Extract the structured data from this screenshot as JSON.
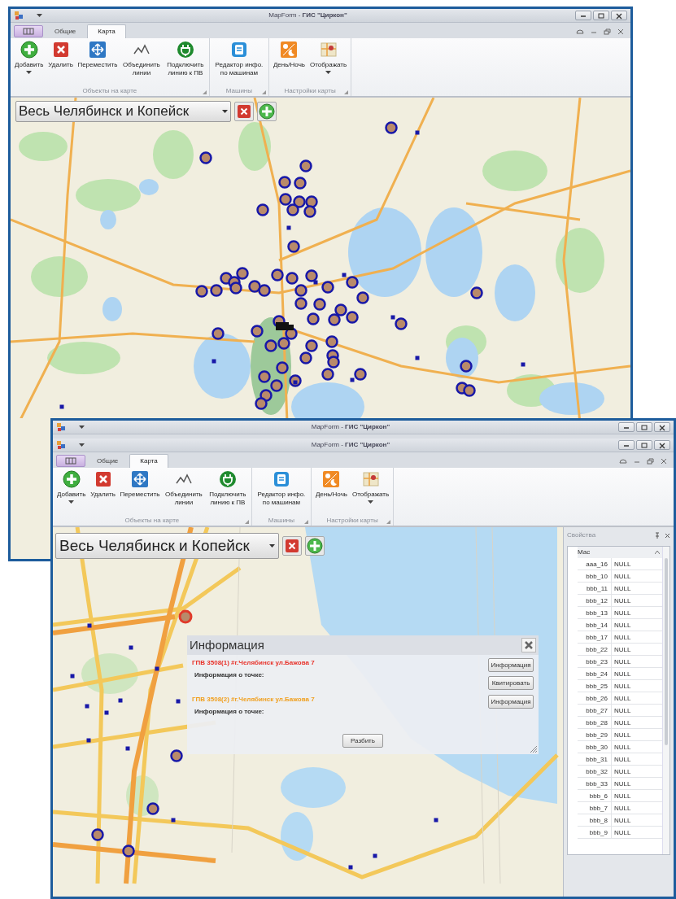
{
  "windows": [
    {
      "title_bars": [
        "MapForm - **ГИС \"Циркон\"**"
      ],
      "tabs": [
        {
          "kind": "app"
        },
        {
          "label": "Общие",
          "kind": "tab",
          "selected": false
        },
        {
          "label": "Карта",
          "kind": "tab",
          "selected": true
        }
      ],
      "ribbon_groups": [
        {
          "label": "Объекты на карте",
          "items": [
            {
              "label": "Добавить",
              "dropdown": true
            },
            {
              "label": "Удалить",
              "dropdown": false
            },
            {
              "label": "Переместить",
              "dropdown": false
            },
            {
              "label": "Объединить линии",
              "dropdown": false
            },
            {
              "label": "Подключить линию к ПВ",
              "dropdown": false
            }
          ]
        },
        {
          "label": "Машины",
          "items": [
            {
              "label": "Редактор инфо. по машинам",
              "dropdown": false
            }
          ]
        },
        {
          "label": "Настройки карты",
          "items": [
            {
              "label": "День/Ночь",
              "dropdown": false
            },
            {
              "label": "Отображать",
              "dropdown": true
            }
          ]
        }
      ],
      "area_combo": {
        "value": "Весь Челябинск и Копейск"
      }
    },
    {
      "title_bars": [
        "MapForm - **ГИС \"Циркон\"**",
        "MapForm - **ГИС \"Циркон\"**"
      ],
      "tabs": [
        {
          "kind": "app"
        },
        {
          "label": "Общие",
          "kind": "tab",
          "selected": false
        },
        {
          "label": "Карта",
          "kind": "tab",
          "selected": true
        }
      ],
      "ribbon_groups": [
        {
          "label": "Объекты на карте",
          "items": [
            {
              "label": "Добавить",
              "dropdown": true
            },
            {
              "label": "Удалить",
              "dropdown": false
            },
            {
              "label": "Переместить",
              "dropdown": false
            },
            {
              "label": "Объединить линии",
              "dropdown": false
            },
            {
              "label": "Подключить линию к ПВ",
              "dropdown": false
            }
          ]
        },
        {
          "label": "Машины",
          "items": [
            {
              "label": "Редактор инфо. по машинам",
              "dropdown": false
            }
          ]
        },
        {
          "label": "Настройки карты",
          "items": [
            {
              "label": "День/Ночь",
              "dropdown": false
            },
            {
              "label": "Отображать",
              "dropdown": true
            }
          ]
        }
      ],
      "area_combo": {
        "value": "Весь Челябинск и Копейск"
      },
      "info_dialog": {
        "title": "Информация",
        "entries": [
          {
            "title": "ГПВ 3508(1) #г.Челябинск ул.Бажова 7",
            "color": "#e8322a",
            "label": "Информация о точке:",
            "buttons": [
              "Информация",
              "Квитировать"
            ]
          },
          {
            "title": "ГПВ 3508(2) #г.Челябинск  ул.Бажова 7",
            "color": "#f0a020",
            "label": "Информация о точке:",
            "buttons": [
              "Информация"
            ]
          }
        ],
        "footer_button": "Разбить"
      },
      "properties": {
        "title": "Свойства",
        "category": "Мас",
        "rows": [
          {
            "name": "aaa_16",
            "value": "NULL"
          },
          {
            "name": "bbb_10",
            "value": "NULL"
          },
          {
            "name": "bbb_11",
            "value": "NULL"
          },
          {
            "name": "bbb_12",
            "value": "NULL"
          },
          {
            "name": "bbb_13",
            "value": "NULL"
          },
          {
            "name": "bbb_14",
            "value": "NULL"
          },
          {
            "name": "bbb_17",
            "value": "NULL"
          },
          {
            "name": "bbb_22",
            "value": "NULL"
          },
          {
            "name": "bbb_23",
            "value": "NULL"
          },
          {
            "name": "bbb_24",
            "value": "NULL"
          },
          {
            "name": "bbb_25",
            "value": "NULL"
          },
          {
            "name": "bbb_26",
            "value": "NULL"
          },
          {
            "name": "bbb_27",
            "value": "NULL"
          },
          {
            "name": "bbb_28",
            "value": "NULL"
          },
          {
            "name": "bbb_29",
            "value": "NULL"
          },
          {
            "name": "bbb_30",
            "value": "NULL"
          },
          {
            "name": "bbb_31",
            "value": "NULL"
          },
          {
            "name": "bbb_32",
            "value": "NULL"
          },
          {
            "name": "bbb_33",
            "value": "NULL"
          },
          {
            "name": "bbb_6",
            "value": "NULL"
          },
          {
            "name": "bbb_7",
            "value": "NULL"
          },
          {
            "name": "bbb_8",
            "value": "NULL"
          },
          {
            "name": "bbb_9",
            "value": "NULL"
          }
        ]
      }
    }
  ]
}
